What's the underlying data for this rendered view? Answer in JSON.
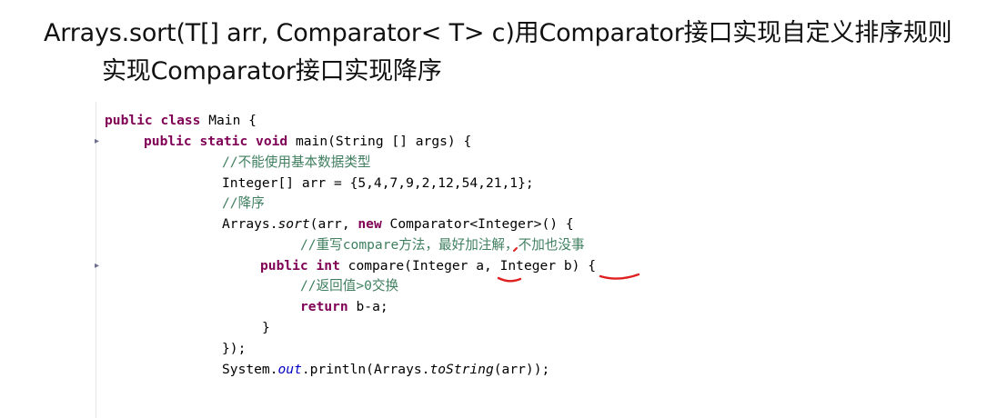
{
  "slide": {
    "title": "Arrays.sort(T[] arr, Comparator< T> c)用Comparator接口实现自定义排序规则",
    "subtitle": "实现Comparator接口实现降序"
  },
  "code": {
    "l1_kw1": "public",
    "l1_kw2": "class",
    "l1_rest": " Main {",
    "l2_kw1": "public",
    "l2_kw2": "static",
    "l2_kw3": "void",
    "l2_rest": " main(String [] args) {",
    "l3_comment": "//不能使用基本数据类型",
    "l4": "Integer[] arr = {5,4,7,9,2,12,54,21,1};",
    "l5_comment": "//降序",
    "l6_a": "Arrays.",
    "l6_sort": "sort",
    "l6_b": "(arr, ",
    "l6_new": "new",
    "l6_c": " Comparator<Integer>() {",
    "l7_comment": "//重写compare方法，最好加注解，不加也没事",
    "l8_kw1": "public",
    "l8_kw2": "int",
    "l8_rest": " compare(Integer a, Integer b) {",
    "l9_comment": "//返回值>0交换",
    "l10_kw": "return",
    "l10_rest": " b-a;",
    "l11": "}",
    "l12": "});",
    "l13_a": "System.",
    "l13_out": "out",
    "l13_b": ".println(Arrays.",
    "l13_tostring": "toString",
    "l13_c": "(arr));"
  },
  "colors": {
    "keyword": "#7f0055",
    "comment": "#3f7f5f",
    "field": "#0000c0",
    "annotation_ink": "#e02020"
  },
  "icons": [
    "fold-marker-icon",
    "fold-marker-icon"
  ]
}
